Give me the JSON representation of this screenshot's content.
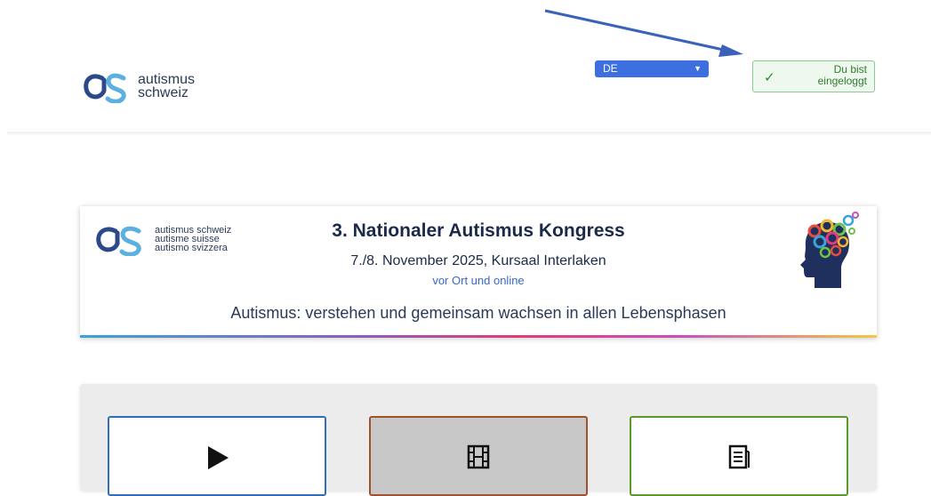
{
  "header": {
    "logo": {
      "line1": "autismus",
      "line2": "schweiz"
    },
    "language_select": {
      "value": "DE"
    },
    "login_status": {
      "line1": "Du bist",
      "line2": "eingeloggt"
    }
  },
  "banner": {
    "logo_lines": [
      "autismus schweiz",
      "autisme suisse",
      "autismo svizzera"
    ],
    "title": "3. Nationaler Autismus Kongress",
    "date": "7./8. November 2025, Kursaal Interlaken",
    "subtitle": "vor Ort und online",
    "motto": "Autismus: verstehen und gemeinsam wachsen in allen Lebensphasen"
  },
  "cards": [
    {
      "icon": "play-icon",
      "border_color": "#2f6fb5"
    },
    {
      "icon": "film-icon",
      "border_color": "#a0522d"
    },
    {
      "icon": "document-icon",
      "border_color": "#5a9a2a"
    }
  ],
  "colors": {
    "brand_dark": "#1c2a4a",
    "brand_blue": "#3d6fe0",
    "success_green": "#2e7d2e",
    "annotation_arrow": "#3a62b8"
  }
}
